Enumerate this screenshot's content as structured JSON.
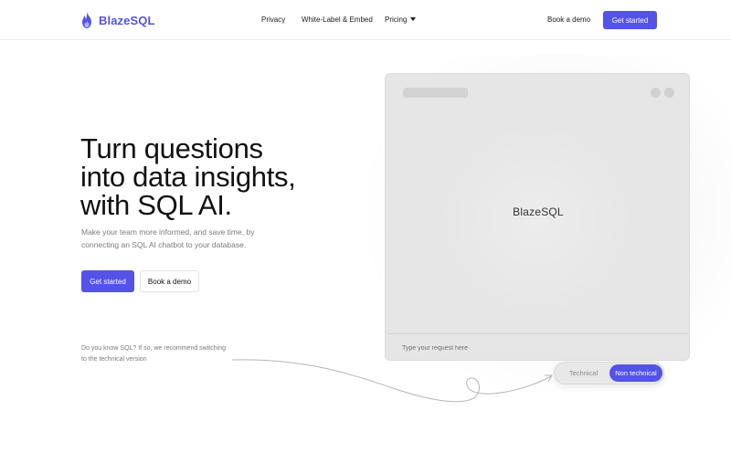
{
  "brand": {
    "name": "BlazeSQL",
    "accent": "#5453e8"
  },
  "nav": {
    "links": [
      {
        "label": "Privacy"
      },
      {
        "label": "White-Label & Embed"
      },
      {
        "label": "Pricing"
      }
    ],
    "book_demo": "Book a demo",
    "get_started": "Get started"
  },
  "hero": {
    "headline_lines": [
      "Turn questions",
      "into data insights,",
      "with SQL AI."
    ],
    "subtext_lines": [
      "Make your team more informed, and save time, by",
      "connecting an SQL AI chatbot to your database."
    ],
    "primary_cta": "Get started",
    "secondary_cta": "Book a demo",
    "hint_lines": [
      "Do you know SQL? If so, we recommend switching",
      "to the technical version"
    ]
  },
  "preview": {
    "brand_label": "BlazeSQL",
    "input_placeholder": "Type your request here"
  },
  "mode_toggle": {
    "options": [
      "Technical",
      "Non technical"
    ],
    "selected": "Non technical"
  }
}
